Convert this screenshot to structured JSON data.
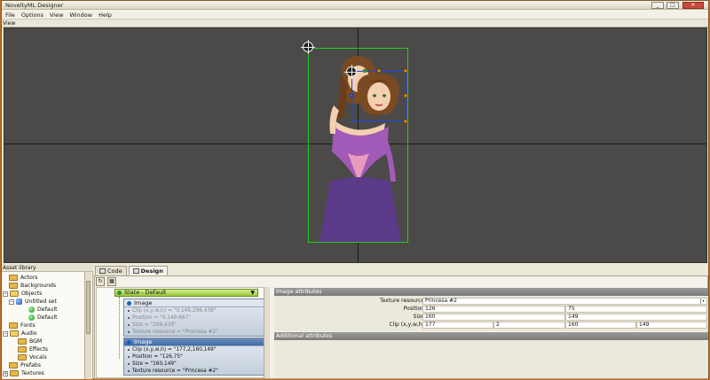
{
  "window": {
    "title": "NoveltyML Designer"
  },
  "menu": [
    "File",
    "Options",
    "View",
    "Window",
    "Help"
  ],
  "view_label": "View",
  "asset_library": {
    "title": "Asset library",
    "items": [
      {
        "label": "Actors",
        "kind": "folder"
      },
      {
        "label": "Backgrounds",
        "kind": "folder"
      },
      {
        "label": "Objects",
        "kind": "folder-open"
      },
      {
        "label": "Untitled set",
        "kind": "set"
      },
      {
        "label": "Default",
        "kind": "state"
      },
      {
        "label": "Default",
        "kind": "state"
      },
      {
        "label": "Fonts",
        "kind": "folder"
      },
      {
        "label": "Audio",
        "kind": "folder-open"
      },
      {
        "label": "BGM",
        "kind": "folder"
      },
      {
        "label": "Effects",
        "kind": "folder"
      },
      {
        "label": "Vocals",
        "kind": "folder"
      },
      {
        "label": "Prefabs",
        "kind": "folder"
      },
      {
        "label": "Textures",
        "kind": "folder"
      }
    ]
  },
  "tabs": {
    "code": "Code",
    "design": "Design"
  },
  "tree": {
    "state_label": "State - Default",
    "nodes": [
      {
        "title": "Image",
        "props": [
          "Clip (x,y,w,h) = \"0,149,296,439\"",
          "Position = \"0,149.667\"",
          "Size = \"296,439\"",
          "Texture resource = \"Princesa #2\""
        ]
      },
      {
        "title": "Image",
        "props": [
          "Clip (x,y,w,h) = \"177,2,160,149\"",
          "Position = \"126,75\"",
          "Size = \"160,149\"",
          "Texture resource = \"Princesa #2\""
        ]
      }
    ]
  },
  "image_attributes": {
    "header": "Image attributes",
    "texture_resource": {
      "label": "Texture resource",
      "value": "Princesa #2"
    },
    "position": {
      "label": "Position",
      "x": "126",
      "y": "75"
    },
    "size": {
      "label": "Size",
      "w": "160",
      "h": "149"
    },
    "clip": {
      "label": "Clip (x,y,w,h)",
      "x": "177",
      "y": "2",
      "w": "160",
      "h": "149"
    }
  },
  "additional_attributes": {
    "header": "Additional attributes"
  }
}
